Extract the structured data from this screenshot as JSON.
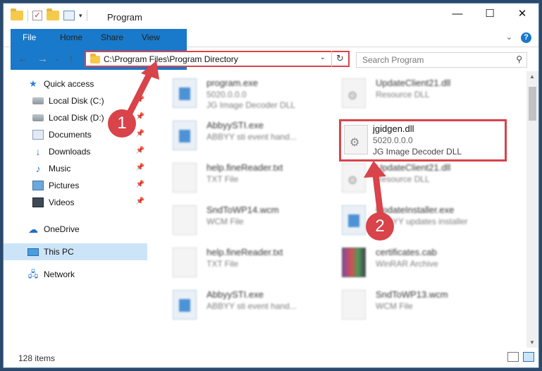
{
  "window": {
    "title": "Program",
    "controls": {
      "minimize": "—",
      "maximize": "☐",
      "close": "✕"
    }
  },
  "ribbon": {
    "tabs": [
      "File",
      "Home",
      "Share",
      "View"
    ],
    "expand": "⌄",
    "help": "?"
  },
  "nav": {
    "back": "←",
    "forward": "→",
    "recent": "⌄",
    "up": "↑",
    "address": "C:\\Program Files\\Program Directory",
    "address_dropdown": "⌄",
    "refresh": "↻",
    "search_placeholder": "Search Program",
    "search_icon": "⚲"
  },
  "sidebar": {
    "items": [
      {
        "label": "Quick access",
        "icon": "star-icon",
        "pinned": false
      },
      {
        "label": "Local Disk (C:)",
        "icon": "disk-icon",
        "pinned": true
      },
      {
        "label": "Local Disk (D:)",
        "icon": "disk-icon",
        "pinned": true
      },
      {
        "label": "Documents",
        "icon": "documents-icon",
        "pinned": true
      },
      {
        "label": "Downloads",
        "icon": "download-icon",
        "pinned": true
      },
      {
        "label": "Music",
        "icon": "music-icon",
        "pinned": true
      },
      {
        "label": "Pictures",
        "icon": "pictures-icon",
        "pinned": true
      },
      {
        "label": "Videos",
        "icon": "videos-icon",
        "pinned": true
      },
      {
        "label": "OneDrive",
        "icon": "onedrive-icon",
        "pinned": false
      },
      {
        "label": "This PC",
        "icon": "pc-icon",
        "pinned": false,
        "selected": true
      },
      {
        "label": "Network",
        "icon": "network-icon",
        "pinned": false
      }
    ]
  },
  "files": [
    {
      "name": "program.exe",
      "line2": "5020.0.0.0",
      "line3": "JG Image Decoder DLL",
      "type": "exe",
      "blurred": true
    },
    {
      "name": "UpdateClient21.dll",
      "line2": "Resource DLL",
      "line3": "",
      "type": "dll",
      "blurred": true
    },
    {
      "name": "AbbyySTI.exe",
      "line2": "ABBYY sti event hand...",
      "line3": "",
      "type": "exe",
      "blurred": true
    },
    {
      "name": "jgidgen.dll",
      "line2": "5020.0.0.0",
      "line3": "JG Image Decoder DLL",
      "type": "dll",
      "blurred": false,
      "highlighted": true
    },
    {
      "name": "help.fineReader.txt",
      "line2": "TXT File",
      "line3": "",
      "type": "txt",
      "blurred": true
    },
    {
      "name": "UpdateClient21.dll",
      "line2": "Resource DLL",
      "line3": "",
      "type": "dll",
      "blurred": true
    },
    {
      "name": "SndToWP14.wcm",
      "line2": "WCM File",
      "line3": "",
      "type": "txt",
      "blurred": true
    },
    {
      "name": "UpdateInstaller.exe",
      "line2": "ABBYY updates installer",
      "line3": "",
      "type": "exe",
      "blurred": true
    },
    {
      "name": "help.fineReader.txt",
      "line2": "TXT File",
      "line3": "",
      "type": "txt",
      "blurred": true
    },
    {
      "name": "certificates.cab",
      "line2": "WinRAR Archive",
      "line3": "",
      "type": "cab",
      "blurred": true
    },
    {
      "name": "AbbyySTI.exe",
      "line2": "ABBYY sti event hand...",
      "line3": "",
      "type": "exe",
      "blurred": true
    },
    {
      "name": "SndToWP13.wcm",
      "line2": "WCM File",
      "line3": "",
      "type": "txt",
      "blurred": true
    }
  ],
  "status": {
    "count": "128 items"
  },
  "annotations": {
    "step1": "1",
    "step2": "2",
    "color": "#d9434a"
  }
}
